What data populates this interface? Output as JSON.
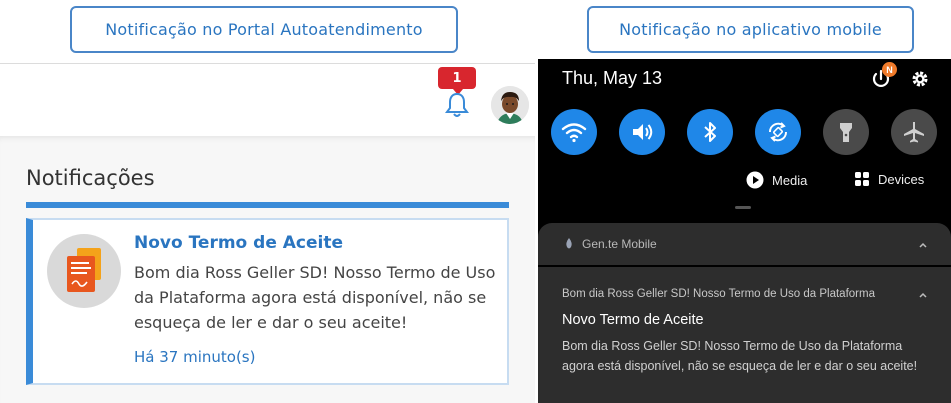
{
  "captions": {
    "left": "Notificação no Portal Autoatendimento",
    "right": "Notificação no aplicativo mobile"
  },
  "portal": {
    "badge_count": "1",
    "panel_title": "Notificações",
    "notification": {
      "title": "Novo Termo de Aceite",
      "body": "Bom dia Ross Geller SD! Nosso Termo de Uso da Plataforma agora está disponível, não se esqueça de ler e dar o seu aceite!",
      "time": "Há 37 minuto(s)"
    },
    "colors": {
      "accent": "#3a8bd8",
      "badge": "#d8262e"
    },
    "icons": [
      "bell-icon",
      "avatar",
      "document-icon"
    ]
  },
  "mobile": {
    "date": "Thu, May 13",
    "power_badge": "N",
    "quick_settings": [
      {
        "name": "wifi-icon",
        "state": "on"
      },
      {
        "name": "volume-icon",
        "state": "on"
      },
      {
        "name": "bluetooth-icon",
        "state": "on"
      },
      {
        "name": "auto-rotate-icon",
        "state": "on"
      },
      {
        "name": "flashlight-icon",
        "state": "off"
      },
      {
        "name": "airplane-icon",
        "state": "off"
      }
    ],
    "media_label": "Media",
    "devices_label": "Devices",
    "app_name": "Gen.te Mobile",
    "notification": {
      "summary": "Bom dia Ross Geller SD! Nosso Termo de Uso da Plataforma",
      "title": "Novo Termo de Aceite",
      "body": "Bom dia Ross Geller SD! Nosso Termo de Uso da Plataforma agora está disponível, não se esqueça de ler e dar o seu aceite!"
    },
    "colors": {
      "tile_on": "#1f87e8",
      "tile_off": "#4a4a4a",
      "card_bg": "#2d2d2d"
    }
  }
}
